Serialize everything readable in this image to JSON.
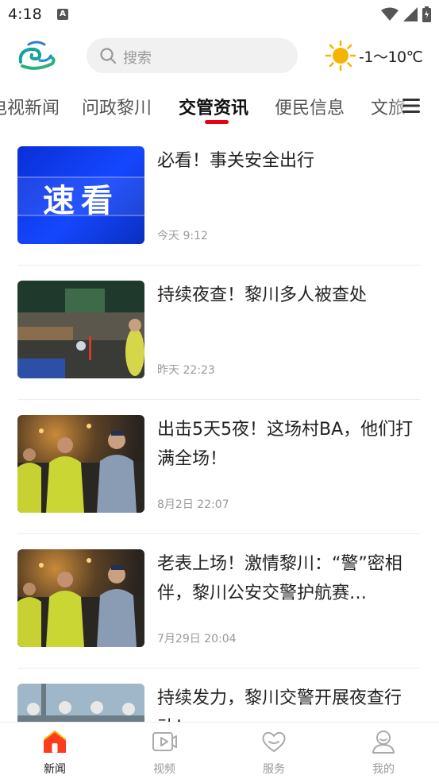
{
  "status_bar": {
    "time": "4:18",
    "notification_icon": "A"
  },
  "header": {
    "logo": "app-logo",
    "search": {
      "placeholder": "搜索"
    },
    "weather": {
      "icon": "sun-icon",
      "temperature": "-1～10℃"
    }
  },
  "tabs": [
    {
      "label": "电视新闻",
      "active": false
    },
    {
      "label": "问政黎川",
      "active": false
    },
    {
      "label": "交管资讯",
      "active": true
    },
    {
      "label": "便民信息",
      "active": false
    },
    {
      "label": "文旅",
      "active": false
    }
  ],
  "feed": [
    {
      "title": "必看！事关安全出行",
      "time": "今天 9:12",
      "thumb_text": "速看"
    },
    {
      "title": "持续夜查！黎川多人被查处",
      "time": "昨天 22:23"
    },
    {
      "title": "出击5天5夜！这场村BA，他们打满全场！",
      "time": "8月2日 22:07"
    },
    {
      "title": "老表上场！激情黎川：“警”密相伴，黎川公安交警护航赛…",
      "time": "7月29日 20:04"
    },
    {
      "title": "持续发力，黎川交警开展夜查行动！",
      "time": ""
    }
  ],
  "bottom_nav": [
    {
      "label": "新闻",
      "icon": "home-icon",
      "active": true
    },
    {
      "label": "视频",
      "icon": "video-icon",
      "active": false
    },
    {
      "label": "服务",
      "icon": "heart-icon",
      "active": false
    },
    {
      "label": "我的",
      "icon": "profile-icon",
      "active": false
    }
  ],
  "colors": {
    "accent": "#e60012",
    "search_bg": "#f1f1f1",
    "sun": "#f5b400"
  }
}
